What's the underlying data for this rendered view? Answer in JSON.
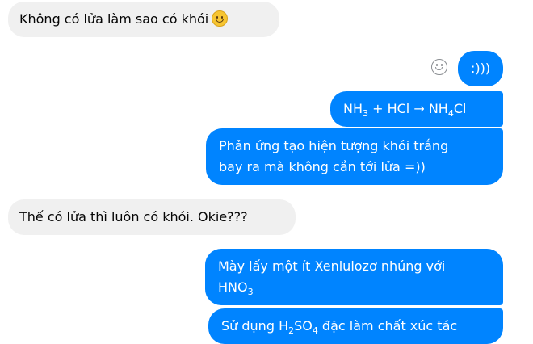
{
  "messages": [
    {
      "sender": "them",
      "text": "Không có lửa làm sao có khói",
      "emoji": "slightly-smiling-face-icon"
    },
    {
      "sender": "me",
      "text": ":)))"
    },
    {
      "sender": "me",
      "equation": {
        "lhs1": "NH",
        "lhs1_sub": "3",
        "op": " + HCl → ",
        "rhs": "NH",
        "rhs_sub": "4",
        "rhs_tail": "Cl"
      }
    },
    {
      "sender": "me",
      "lines": [
        "Phản ứng tạo hiện tượng khói trắng",
        "bay ra mà không cần tới lửa =))"
      ]
    },
    {
      "sender": "them",
      "text": "Thế có lửa thì luôn có khói. Okie???"
    },
    {
      "sender": "me",
      "lines": [
        "Mày lấy một ít Xenlulozơ nhúng với"
      ],
      "line2": "HNO",
      "line2_sub": "3"
    },
    {
      "sender": "me",
      "pre": "Sử dụng H",
      "sub1": "2",
      "mid": "SO",
      "sub2": "4",
      "post": " đặc làm chất xúc tác"
    }
  ],
  "colors": {
    "incoming_bg": "#f0f0f0",
    "outgoing_bg": "#0084ff",
    "react_icon": "#8a8d91"
  },
  "icons": {
    "reaction": "smiley-reaction-icon"
  }
}
